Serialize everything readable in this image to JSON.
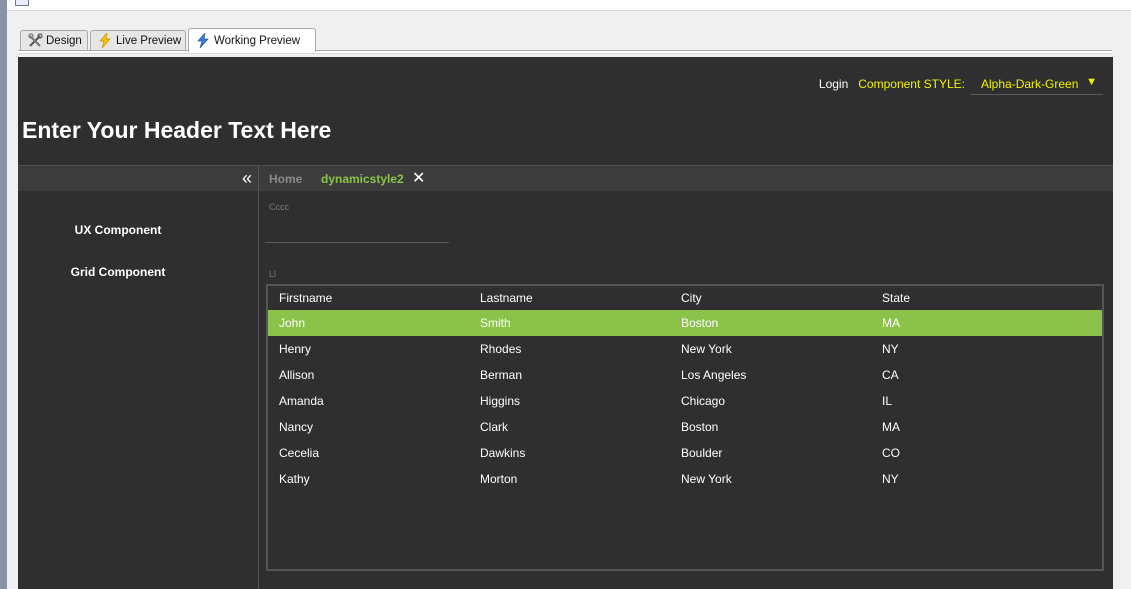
{
  "tabs": [
    {
      "label": "Design",
      "icon": "tools-icon"
    },
    {
      "label": "Live Preview",
      "icon": "lightning-icon"
    },
    {
      "label": "Working Preview",
      "icon": "lightning-icon"
    }
  ],
  "topbar": {
    "login": "Login",
    "style_label": "Component STYLE:",
    "style_value": "Alpha-Dark-Green"
  },
  "header_text": "Enter Your Header Text Here",
  "sidebar": {
    "items": [
      "UX Component",
      "Grid Component"
    ]
  },
  "main_tabs": {
    "home": "Home",
    "active": "dynamicstyle2"
  },
  "fields": {
    "cccc_label": "Cccc",
    "ll_label": "Ll"
  },
  "grid": {
    "columns": [
      "Firstname",
      "Lastname",
      "City",
      "State"
    ],
    "rows": [
      [
        "John",
        "Smith",
        "Boston",
        "MA"
      ],
      [
        "Henry",
        "Rhodes",
        "New York",
        "NY"
      ],
      [
        "Allison",
        "Berman",
        "Los Angeles",
        "CA"
      ],
      [
        "Amanda",
        "Higgins",
        "Chicago",
        "IL"
      ],
      [
        "Nancy",
        "Clark",
        "Boston",
        "MA"
      ],
      [
        "Cecelia",
        "Dawkins",
        "Boulder",
        "CO"
      ],
      [
        "Kathy",
        "Morton",
        "New York",
        "NY"
      ]
    ],
    "selected_row": 0
  },
  "colors": {
    "accent_green": "#8bc34a",
    "style_yellow": "#f2f200",
    "app_bg": "#2f2f2f"
  }
}
